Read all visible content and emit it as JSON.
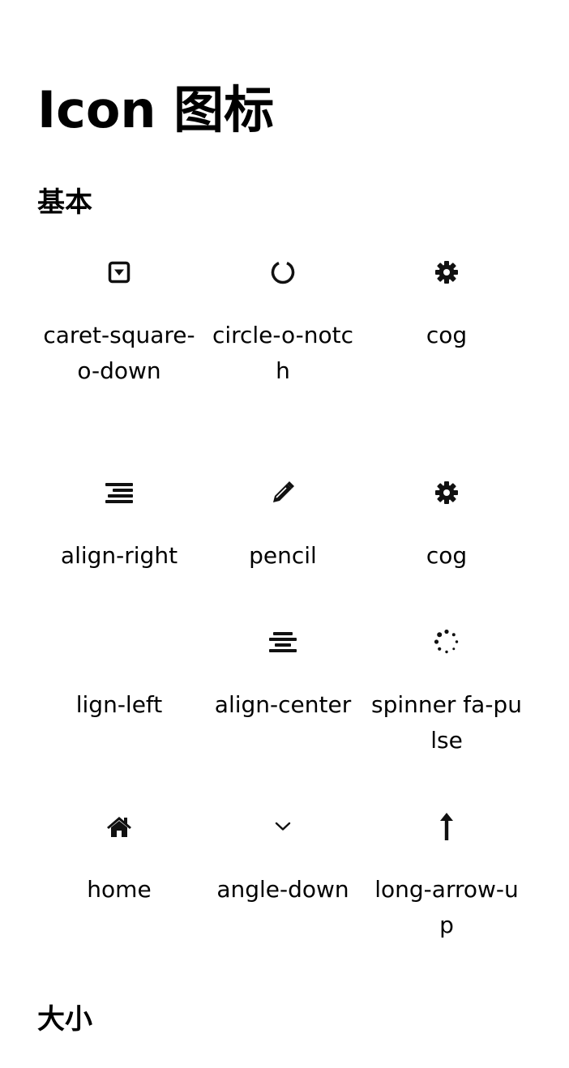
{
  "page": {
    "title": "Icon 图标",
    "sections": {
      "basic": "基本",
      "size": "大小"
    }
  },
  "icons": [
    {
      "icon": "caret-square-o-down-icon",
      "label": "caret-square-o-down"
    },
    {
      "icon": "circle-o-notch-icon",
      "label": "circle-o-notch"
    },
    {
      "icon": "cog-icon",
      "label": "cog"
    },
    {
      "icon": "align-right-icon",
      "label": "align-right"
    },
    {
      "icon": "pencil-icon",
      "label": "pencil"
    },
    {
      "icon": "cog-icon",
      "label": "cog"
    },
    {
      "icon": "align-left-icon",
      "label": "lign-left"
    },
    {
      "icon": "align-center-icon",
      "label": "align-center"
    },
    {
      "icon": "spinner-icon",
      "label": "spinner fa-pulse"
    },
    {
      "icon": "home-icon",
      "label": "home"
    },
    {
      "icon": "angle-down-icon",
      "label": "angle-down"
    },
    {
      "icon": "long-arrow-up-icon",
      "label": "long-arrow-up"
    }
  ]
}
